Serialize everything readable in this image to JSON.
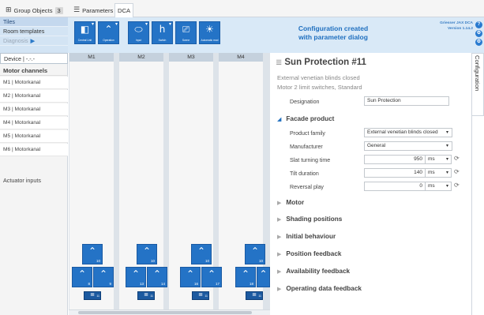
{
  "tabs": [
    {
      "icon": "group-objects-icon",
      "label": "Group Objects",
      "count": "3"
    },
    {
      "icon": "parameters-icon",
      "label": "Parameters"
    },
    {
      "label": "DCA"
    }
  ],
  "nav": {
    "tiles": "Tiles",
    "room_templates": "Room templates",
    "diagnosis": "Diagnosis",
    "diagnosis_arrow": "▶"
  },
  "ribbon": {
    "buttons": [
      {
        "label": "Central Unit",
        "icon": "central-unit-icon"
      },
      {
        "label": "Operation",
        "icon": "operation-icon"
      },
      {
        "label": "Input",
        "icon": "input-icon"
      },
      {
        "label": "Switch",
        "icon": "switch-icon"
      },
      {
        "label": "Scene",
        "icon": "scene-icon"
      },
      {
        "label": "Automatic mod",
        "icon": "automatic-mode-icon"
      }
    ],
    "title_line1": "Configuration created",
    "title_line2": "with parameter dialog",
    "version_line1": "Griesser JAX DCA",
    "version_line2": "Version 1.14.2",
    "side_icons": [
      "help-icon",
      "settings-icon",
      "gear-icon"
    ]
  },
  "left": {
    "device_select": "Device | -.-.-",
    "motor_channels": "Motor channels",
    "channels": [
      "M1 | Motorkanal",
      "M2 | Motorkanal",
      "M3 | Motorkanal",
      "M4 | Motorkanal",
      "M5 | Motorkanal",
      "M6 | Motorkanal"
    ],
    "actuator_inputs": "Actuator inputs"
  },
  "grid": {
    "columns": [
      "M1",
      "M2",
      "M3",
      "M4"
    ],
    "columns_data": [
      {
        "top": "10",
        "left": "8",
        "right": "9",
        "bottom": "11"
      },
      {
        "top": "10",
        "left": "13",
        "right": "14",
        "bottom": "11"
      },
      {
        "top": "10",
        "left": "16",
        "right": "17",
        "bottom": "11"
      },
      {
        "top": "10",
        "left": "18",
        "right": "",
        "bottom": "11"
      }
    ]
  },
  "panel": {
    "title": "Sun Protection #11",
    "subtitle1": "External venetian blinds closed",
    "subtitle2": "Motor 2 limit switches, Standard",
    "designation_label": "Designation",
    "designation_value": "Sun Protection",
    "facade_section": "Facade product",
    "product_family_label": "Product family",
    "product_family_value": "External venetian blinds closed",
    "manufacturer_label": "Manufacturer",
    "manufacturer_value": "General",
    "slat_label": "Slat turning time",
    "slat_value": "950",
    "tilt_label": "Tilt duration",
    "tilt_value": "140",
    "reversal_label": "Reversal play",
    "reversal_value": "0",
    "unit": "ms",
    "sections": [
      "Motor",
      "Shading positions",
      "Initial behaviour",
      "Position feedback",
      "Availability feedback",
      "Operating data feedback"
    ]
  },
  "config_tab": "Configuration"
}
